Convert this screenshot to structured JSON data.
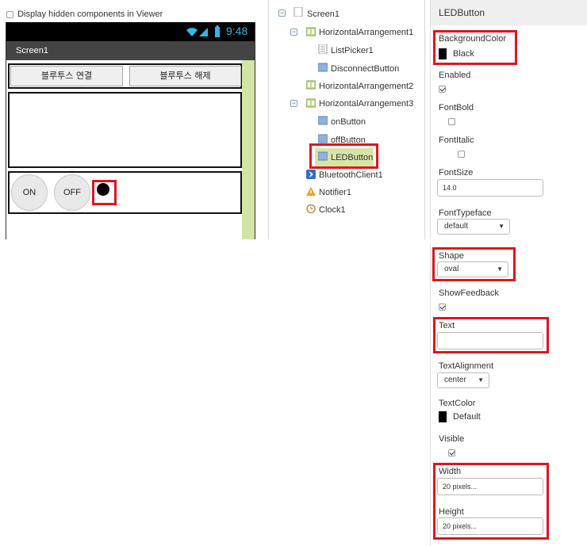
{
  "viewer": {
    "hidden_checkbox_label": "Display hidden components in Viewer",
    "status_time": "9:48",
    "screen_title": "Screen1",
    "buttons": {
      "connect": "블루투스 연결",
      "disconnect": "블루투스 해제",
      "on": "ON",
      "off": "OFF"
    }
  },
  "tree": {
    "screen1": "Screen1",
    "horizontal_arrangement1": "HorizontalArrangement1",
    "list_picker1": "ListPicker1",
    "disconnect_button": "DisconnectButton",
    "horizontal_arrangement2": "HorizontalArrangement2",
    "horizontal_arrangement3": "HorizontalArrangement3",
    "on_button": "onButton",
    "off_button": "offButton",
    "led_button": "LEDButton",
    "bluetooth_client1": "BluetoothClient1",
    "notifier1": "Notifier1",
    "clock1": "Clock1"
  },
  "properties": {
    "component_name": "LEDButton",
    "background_color": {
      "label": "BackgroundColor",
      "value": "Black"
    },
    "enabled": {
      "label": "Enabled"
    },
    "font_bold": {
      "label": "FontBold"
    },
    "font_italic": {
      "label": "FontItalic"
    },
    "font_size": {
      "label": "FontSize",
      "value": "14.0"
    },
    "font_typeface": {
      "label": "FontTypeface",
      "value": "default"
    },
    "shape": {
      "label": "Shape",
      "value": "oval"
    },
    "show_feedback": {
      "label": "ShowFeedback"
    },
    "text": {
      "label": "Text",
      "value": ""
    },
    "text_alignment": {
      "label": "TextAlignment",
      "value": "center"
    },
    "text_color": {
      "label": "TextColor",
      "value": "Default"
    },
    "visible": {
      "label": "Visible"
    },
    "width": {
      "label": "Width",
      "value": "20 pixels..."
    },
    "height": {
      "label": "Height",
      "value": "20 pixels..."
    }
  },
  "colors": {
    "highlight": "#e0161f",
    "selected_row": "#d7e6a5",
    "titlebar": "#444444"
  }
}
